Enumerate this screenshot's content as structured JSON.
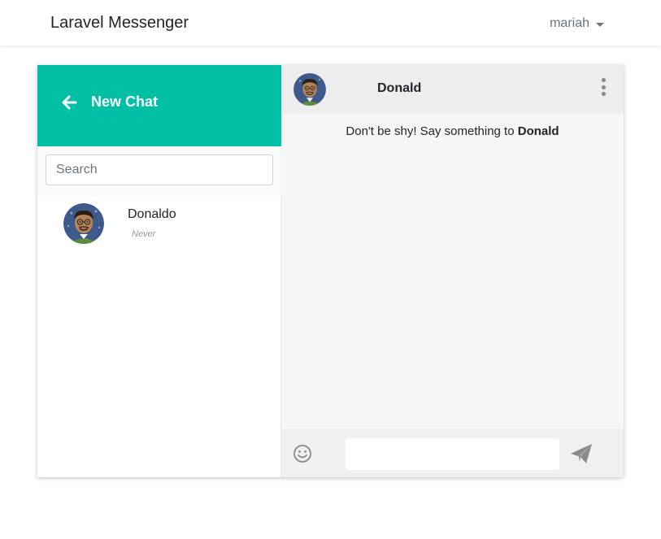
{
  "navbar": {
    "brand": "Laravel Messenger",
    "user": "mariah"
  },
  "sidebar": {
    "title": "New Chat",
    "search_placeholder": "Search",
    "contacts": [
      {
        "name": "Donaldo",
        "status": "Never"
      }
    ]
  },
  "chat": {
    "contact_name": "Donald",
    "empty_prefix": "Don't be shy! Say something to ",
    "empty_name": "Donald",
    "input_value": ""
  },
  "colors": {
    "accent": "#00bfa5",
    "chat_bg": "#f6f6f6",
    "header_bg": "#ededed",
    "footer_bg": "#f2f0ee"
  },
  "icons": {
    "back": "arrow-left-icon",
    "menu": "kebab-menu-icon",
    "emoji": "smiley-icon",
    "send": "paper-plane-icon",
    "user_menu": "caret-down-icon"
  }
}
